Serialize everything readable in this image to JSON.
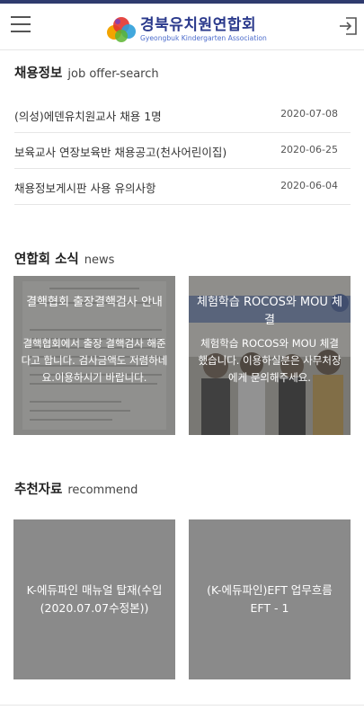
{
  "header": {
    "logo_title": "경북유치원연합회",
    "logo_subtitle": "Gyeongbuk Kindergarten Association",
    "menu_icon": "hamburger-menu-icon",
    "login_icon": "login-icon"
  },
  "jobs": {
    "title": "채용정보",
    "subtitle": "job offer-search",
    "items": [
      {
        "title": "(의성)에덴유치원교사 채용 1명",
        "date": "2020-07-08"
      },
      {
        "title": "보육교사 연장보육반 채용공고(천사어린이집)",
        "date": "2020-06-25"
      },
      {
        "title": "채용정보게시판 사용 유의사항",
        "date": "2020-06-04"
      }
    ]
  },
  "news": {
    "title": "연합회 소식",
    "subtitle": "news",
    "items": [
      {
        "title": "결핵협회 출장결핵검사 안내",
        "desc": "결핵협회에서 출장 결핵검사 해준다고 합니다. 검사금액도 저렴하네요.이용하시기 바랍니다."
      },
      {
        "title": "체험학습 ROCOS와 MOU 체결",
        "desc": "체험학습 ROCOS와 MOU 체결했습니다. 이용하실분은 사무처장에게 문의해주세요."
      }
    ]
  },
  "recommend": {
    "title": "추천자료",
    "subtitle": "recommend",
    "items": [
      {
        "title": "K-에듀파인 매뉴얼 탑재(수입(2020.07.07수정본))"
      },
      {
        "title": "(K-에듀파인)EFT 업무흐름 EFT - 1"
      }
    ]
  },
  "colors": {
    "brand": "#2b3a8c",
    "topbar": "#2f3b6e",
    "card_gray": "#8a8a8a"
  }
}
